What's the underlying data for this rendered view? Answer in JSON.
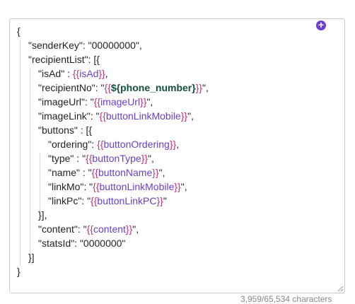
{
  "editor": {
    "add_button_label": "+",
    "counter": "3,959/65,534 characters",
    "lines": {
      "l0": {
        "text": "{"
      },
      "l1": {
        "text": "\"senderKey\": \"00000000\","
      },
      "l2": {
        "text": "\"recipientList\": [{"
      },
      "l3": {
        "pre": "\"isAd\" : ",
        "o": "{{",
        "var": "isAd",
        "c": "}}",
        "post": ","
      },
      "l4": {
        "pre": "\"recipientNo\": \"",
        "o": "{{",
        "var": "${phone_number}",
        "c": "}}",
        "post": "\","
      },
      "l5": {
        "pre": "\"imageUrl\": \"",
        "o": "{{",
        "var": "imageUrl",
        "c": "}}",
        "post": "\","
      },
      "l6": {
        "pre": "\"imageLink\": \"",
        "o": "{{",
        "var": "buttonLinkMobile",
        "c": "}}",
        "post": "\","
      },
      "l7": {
        "text": "\"buttons\" : [{"
      },
      "l8": {
        "pre": "\"ordering\": ",
        "o": "{{",
        "var": "buttonOrdering",
        "c": "}}",
        "post": ","
      },
      "l9": {
        "pre": "\"type\" : \"",
        "o": "{{",
        "var": "buttonType",
        "c": "}}",
        "post": "\","
      },
      "l10": {
        "pre": "\"name\" : \"",
        "o": "{{",
        "var": "buttonName",
        "c": "}}",
        "post": "\","
      },
      "l11": {
        "pre": "\"linkMo\": \"",
        "o": "{{",
        "var": "buttonLinkMobile",
        "c": "}}",
        "post": "\","
      },
      "l12": {
        "pre": "\"linkPc\": \"",
        "o": "{{",
        "var": "buttonLinkPC",
        "c": "}}",
        "post": "\""
      },
      "l13": {
        "text": "}],"
      },
      "l14": {
        "pre": "\"content\": \"",
        "o": "{{",
        "var": "content",
        "c": "}}",
        "post": "\","
      },
      "l15": {
        "text": "\"statsId\": \"0000000\""
      },
      "l16": {
        "text": "}]"
      },
      "l17": {
        "text": "}"
      }
    }
  }
}
